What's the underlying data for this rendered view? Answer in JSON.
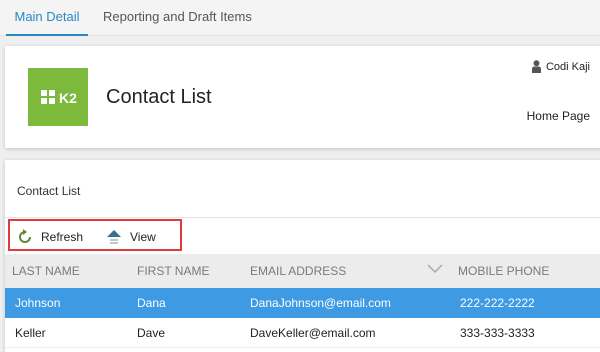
{
  "tabs": [
    {
      "label": "Main Detail"
    },
    {
      "label": "Reporting and Draft Items"
    }
  ],
  "header": {
    "logo_text": "K2",
    "title": "Contact List",
    "user_name": "Codi Kaji",
    "home_link": "Home Page"
  },
  "list": {
    "title": "Contact List",
    "toolbar": {
      "refresh_label": "Refresh",
      "view_label": "View"
    },
    "columns": [
      "LAST NAME",
      "FIRST NAME",
      "EMAIL ADDRESS",
      "MOBILE PHONE"
    ],
    "rows": [
      {
        "last": "Johnson",
        "first": "Dana",
        "email": "DanaJohnson@email.com",
        "phone": "222-222-2222"
      },
      {
        "last": "Keller",
        "first": "Dave",
        "email": "DaveKeller@email.com",
        "phone": "333-333-3333"
      }
    ]
  },
  "colors": {
    "accent": "#2a88c7",
    "logo_green": "#7db93b",
    "selected_row": "#3d9ae3",
    "highlight_border": "#e03a3a"
  }
}
